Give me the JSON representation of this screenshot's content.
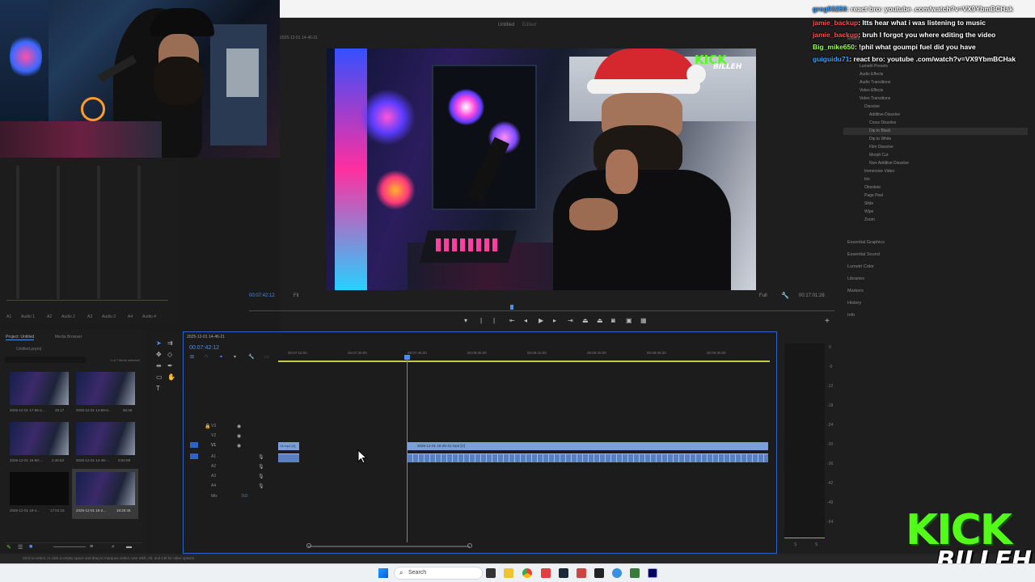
{
  "premiere": {
    "project_title": "Untitled",
    "edited_label": "Edited",
    "sequence_title": "2025-12-01 14-46-21",
    "playhead_tc": "00:07:42:12",
    "fit_label": "Fit",
    "full_label": "Full",
    "duration_tc": "00:17:01:28",
    "timeline_tc": "00:07:42:12",
    "sequence_tab": "2025-12-01 14-46-21",
    "status_hint": "Click to select, or click in empty space and drag to marquee select. Use Shift, Alt, and Ctrl for other options."
  },
  "audio_meters": {
    "channels": [
      "Audio 1",
      "Audio 2",
      "Audio 3",
      "Audio 4"
    ],
    "labels": [
      "A1",
      "A2",
      "A3",
      "A4"
    ]
  },
  "project_panel": {
    "tabs": [
      "Project: Untitled",
      "Media Browser"
    ],
    "file": "Untitled.prproj",
    "count": "1 of 7 items selected",
    "items": [
      {
        "name": "2025-12-01 17-56-4...",
        "dur": "26:17"
      },
      {
        "name": "2025-12-01 14-59-0...",
        "dur": "56:46"
      },
      {
        "name": "2025-12-01 15-50-...",
        "dur": "2:45:53"
      },
      {
        "name": "2025-12-01 14-48-...",
        "dur": "0:02:09"
      },
      {
        "name": "2025-12-01 18-4...",
        "dur": "17:01:18"
      },
      {
        "name": "2025-12-01 15-2...",
        "dur": "18:25:46"
      }
    ]
  },
  "timeline": {
    "ruler": [
      "00:07:15:00",
      "00:07:30:00",
      "00:07:45:00",
      "00:08:00:00",
      "00:08:15:00",
      "00:08:30:00",
      "00:08:45:00",
      "00:09:00:00"
    ],
    "tracks_video": [
      "V3",
      "V2",
      "V1"
    ],
    "tracks_audio": [
      "A1",
      "A2",
      "A3",
      "A4"
    ],
    "mix_label": "Mix",
    "mix_value": "0.0",
    "clip_left": "14.mp4 [V]",
    "clip_main": "2025-12-01 15-25-31.mp4 [V]",
    "db_scale": [
      "0",
      "-6",
      "-12",
      "-18",
      "-24",
      "-30",
      "-36",
      "-42",
      "-48",
      "-54"
    ],
    "meter_labels": [
      "S",
      "S"
    ]
  },
  "effects_panel": {
    "header": "Effects",
    "items": [
      {
        "label": "Lumetri Presets",
        "indent": 1
      },
      {
        "label": "Audio Effects",
        "indent": 1
      },
      {
        "label": "Audio Transitions",
        "indent": 1
      },
      {
        "label": "Video Effects",
        "indent": 1
      },
      {
        "label": "Video Transitions",
        "indent": 1
      },
      {
        "label": "Dissolve",
        "indent": 2
      },
      {
        "label": "Additive Dissolve",
        "indent": 3
      },
      {
        "label": "Cross Dissolve",
        "indent": 3
      },
      {
        "label": "Dip to Black",
        "indent": 3
      },
      {
        "label": "Dip to White",
        "indent": 3
      },
      {
        "label": "Film Dissolve",
        "indent": 3
      },
      {
        "label": "Morph Cut",
        "indent": 3
      },
      {
        "label": "Non-Additive Dissolve",
        "indent": 3
      },
      {
        "label": "Immersive Video",
        "indent": 2
      },
      {
        "label": "Iris",
        "indent": 2
      },
      {
        "label": "Obsolete",
        "indent": 2
      },
      {
        "label": "Page Peel",
        "indent": 2
      },
      {
        "label": "Slide",
        "indent": 2
      },
      {
        "label": "Wipe",
        "indent": 2
      },
      {
        "label": "Zoom",
        "indent": 2
      }
    ],
    "selected_index": 8,
    "panels": [
      "Essential Graphics",
      "Essential Sound",
      "Lumetri Color",
      "Libraries",
      "Markers",
      "History",
      "Info"
    ]
  },
  "chat": [
    {
      "user": "greg93250",
      "color": "#3aa0ff",
      "text": ": react bro: youtube .com/watch?v=VX9YbmBCHak"
    },
    {
      "user": "jamie_backup",
      "color": "#ff4d4d",
      "text": ": Itts hear what i was listening to music"
    },
    {
      "user": "jamie_backup",
      "color": "#ff4d4d",
      "text": ": bruh I forgot you where editing the video"
    },
    {
      "user": "Big_mike650",
      "color": "#9cff4a",
      "text": ": !phil what goumpi fuel did you have"
    },
    {
      "user": "guiguidu71",
      "color": "#3aa0ff",
      "text": ": react bro: youtube .com/watch?v=VX9YbmBCHak"
    }
  ],
  "overlay": {
    "kick_top": "KICK",
    "kick_bottom": "BILLEH"
  },
  "taskbar": {
    "search_placeholder": "Search"
  },
  "colors": {
    "accent": "#2e63c7",
    "clip_video": "#7b9fd8",
    "clip_audio": "#5b7fc0",
    "kick_green": "#53fc18"
  }
}
